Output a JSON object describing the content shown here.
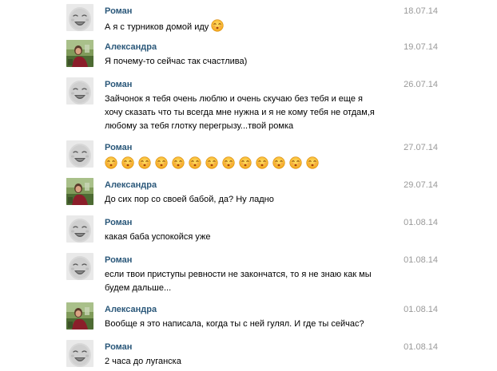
{
  "messages": [
    {
      "author": "Роман",
      "date": "18.07.14",
      "avatar": "baby-avatar",
      "text": "А я с турников домой иду",
      "emoji_count": 1
    },
    {
      "author": "Александра",
      "date": "19.07.14",
      "avatar": "photo-avatar",
      "text": "Я почему-то сейчас так счастлива)",
      "emoji_count": 0
    },
    {
      "author": "Роман",
      "date": "26.07.14",
      "avatar": "baby-avatar",
      "lines": [
        "Зайчонок я тебя очень люблю и очень скучаю без тебя и еще я",
        "хочу сказать что ты всегда мне нужна и я не кому тебя не отдам,я",
        "любому за тебя глотку перегрызу...твой ромка"
      ],
      "emoji_count": 0
    },
    {
      "author": "Роман",
      "date": "27.07.14",
      "avatar": "baby-avatar",
      "text": "",
      "emoji_count": 13
    },
    {
      "author": "Александра",
      "date": "29.07.14",
      "avatar": "photo-avatar",
      "text": "До сих пор со своей бабой, да? Ну ладно",
      "emoji_count": 0
    },
    {
      "author": "Роман",
      "date": "01.08.14",
      "avatar": "baby-avatar",
      "text": "какая баба успокойся уже",
      "emoji_count": 0
    },
    {
      "author": "Роман",
      "date": "01.08.14",
      "avatar": "baby-avatar",
      "lines": [
        "если твои приступы ревности не закончатся, то я не знаю как мы",
        "будем дальше..."
      ],
      "emoji_count": 0
    },
    {
      "author": "Александра",
      "date": "01.08.14",
      "avatar": "photo-avatar",
      "text": "Вообще я это написала, когда ты с ней гулял. И где ты сейчас?",
      "emoji_count": 0
    },
    {
      "author": "Роман",
      "date": "01.08.14",
      "avatar": "baby-avatar",
      "text": "2 часа до луганска",
      "emoji_count": 0
    }
  ],
  "emoji": {
    "name": "kissing-face-emoji",
    "color": "#f7b733"
  },
  "colors": {
    "author": "#2b587a",
    "date": "#999999",
    "text": "#000000"
  }
}
